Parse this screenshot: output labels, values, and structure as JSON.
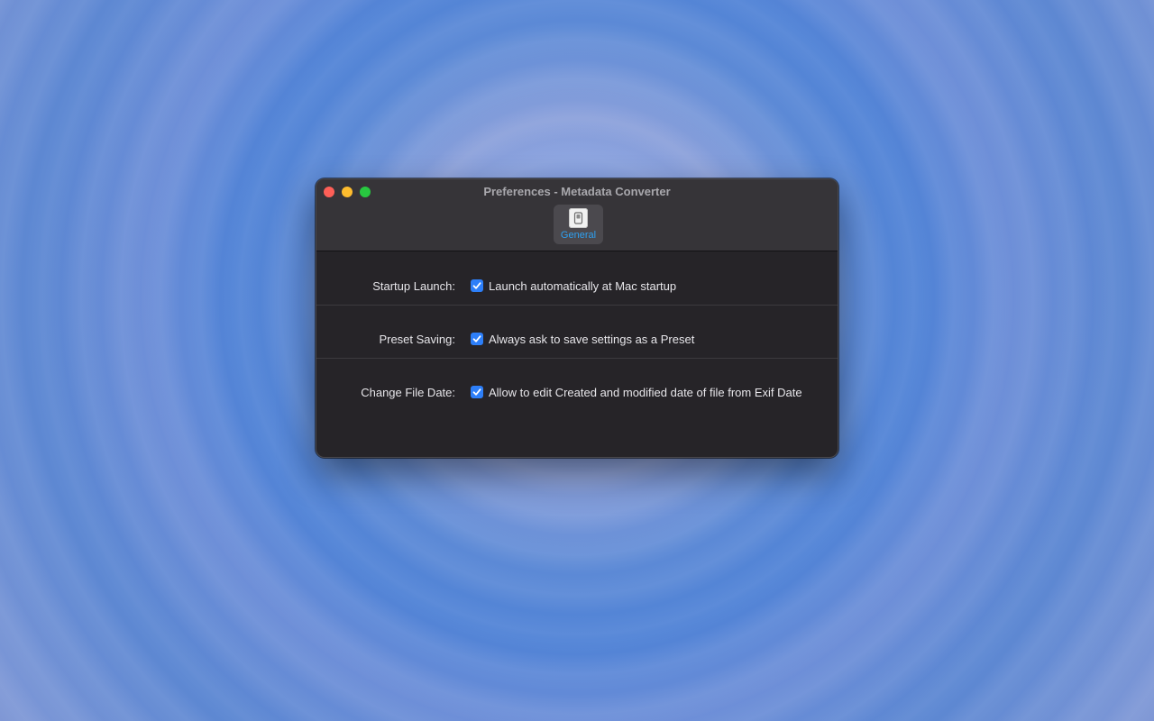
{
  "window": {
    "title": "Preferences - Metadata Converter"
  },
  "toolbar": {
    "tabs": [
      {
        "label": "General",
        "icon": "switch-icon",
        "selected": true
      }
    ]
  },
  "settings": [
    {
      "label": "Startup Launch:",
      "option": "Launch automatically at Mac startup",
      "checked": true
    },
    {
      "label": "Preset Saving:",
      "option": "Always ask to save settings as a Preset",
      "checked": true
    },
    {
      "label": "Change File Date:",
      "option": "Allow to edit Created and modified date of file from Exif Date",
      "checked": true
    }
  ],
  "colors": {
    "accent": "#2d7ff9",
    "tab_label": "#2ea0f0",
    "close": "#fe5f57",
    "minimize": "#febc2e",
    "maximize": "#28c840"
  }
}
